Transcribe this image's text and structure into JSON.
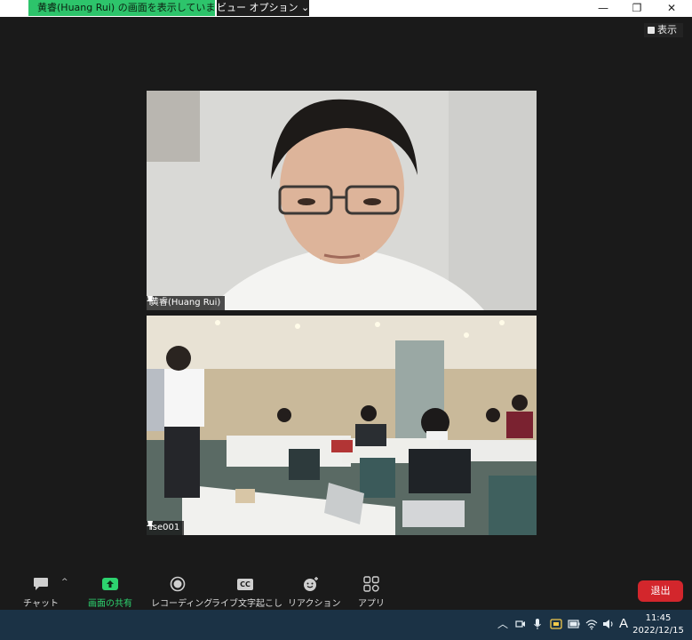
{
  "window": {
    "share_banner": "黄睿(Huang Rui) の画面を表示しています",
    "view_options": "ビュー オプション ⌄",
    "minimize": "—",
    "restore": "❐",
    "close": "✕"
  },
  "view_toggle": {
    "label": "表示"
  },
  "participants": [
    {
      "name": "黄睿(Huang Rui)"
    },
    {
      "name": "ise001"
    }
  ],
  "toolbar": {
    "chat": "チャット",
    "share": "画面の共有",
    "record": "レコーディング",
    "captions": "ライブ文字起こし",
    "captions_badge": "CC",
    "reactions": "リアクション",
    "apps": "アプリ",
    "leave": "退出",
    "caret": "^"
  },
  "taskbar": {
    "ime": "A",
    "time": "11:45",
    "date": "2022/12/15"
  },
  "colors": {
    "share_green": "#2dc46b",
    "leave_red": "#d3262c",
    "taskbar": "#1b3245"
  }
}
